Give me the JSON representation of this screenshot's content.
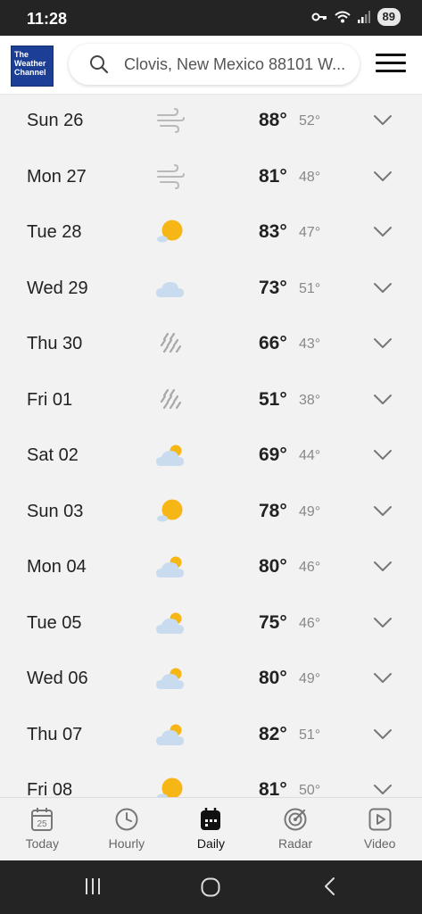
{
  "status_bar": {
    "time": "11:28",
    "battery": "89"
  },
  "header": {
    "logo_lines": [
      "The",
      "Weather",
      "Channel"
    ],
    "search_value": "Clovis, New Mexico 88101 W..."
  },
  "days": [
    {
      "day": "Sun 26",
      "high": "88°",
      "low": "52°",
      "icon": "wind-icon"
    },
    {
      "day": "Mon 27",
      "high": "81°",
      "low": "48°",
      "icon": "wind-icon"
    },
    {
      "day": "Tue 28",
      "high": "83°",
      "low": "47°",
      "icon": "sunny-icon"
    },
    {
      "day": "Wed 29",
      "high": "73°",
      "low": "51°",
      "icon": "cloudy-icon"
    },
    {
      "day": "Thu 30",
      "high": "66°",
      "low": "43°",
      "icon": "rain-icon"
    },
    {
      "day": "Fri 01",
      "high": "51°",
      "low": "38°",
      "icon": "rain-icon"
    },
    {
      "day": "Sat 02",
      "high": "69°",
      "low": "44°",
      "icon": "partly-cloudy-icon"
    },
    {
      "day": "Sun 03",
      "high": "78°",
      "low": "49°",
      "icon": "sunny-icon"
    },
    {
      "day": "Mon 04",
      "high": "80°",
      "low": "46°",
      "icon": "partly-cloudy-icon"
    },
    {
      "day": "Tue 05",
      "high": "75°",
      "low": "46°",
      "icon": "partly-cloudy-icon"
    },
    {
      "day": "Wed 06",
      "high": "80°",
      "low": "49°",
      "icon": "partly-cloudy-icon"
    },
    {
      "day": "Thu 07",
      "high": "82°",
      "low": "51°",
      "icon": "partly-cloudy-icon"
    },
    {
      "day": "Fri 08",
      "high": "81°",
      "low": "50°",
      "icon": "sunny-icon"
    }
  ],
  "bottom_nav": [
    {
      "label": "Today",
      "icon": "calendar-icon",
      "badge": "25",
      "active": false
    },
    {
      "label": "Hourly",
      "icon": "clock-icon",
      "active": false
    },
    {
      "label": "Daily",
      "icon": "calendar-grid-icon",
      "active": true
    },
    {
      "label": "Radar",
      "icon": "radar-icon",
      "active": false
    },
    {
      "label": "Video",
      "icon": "play-icon",
      "active": false
    }
  ],
  "colors": {
    "brand_blue": "#1c3e94",
    "sun_yellow": "#f6b616",
    "cloud_blue": "#c9dcef",
    "text_dark": "#222222",
    "text_muted": "#888888"
  }
}
